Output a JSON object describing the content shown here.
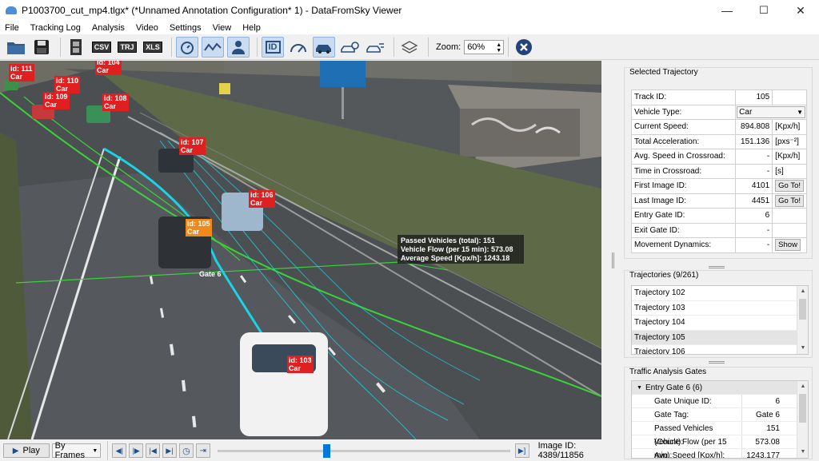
{
  "window": {
    "title": "P1003700_cut_mp4.tlgx* (*Unnamed Annotation Configuration* 1) - DataFromSky Viewer",
    "controls": {
      "minimize": "—",
      "maximize": "☐",
      "close": "✕"
    }
  },
  "menu": [
    "File",
    "Tracking Log",
    "Analysis",
    "Video",
    "Settings",
    "View",
    "Help"
  ],
  "toolbar": {
    "buttons": [
      "open-folder",
      "save",
      "film",
      "CSV",
      "TRJ",
      "XLS",
      "speed-timer",
      "trajectory-path",
      "person",
      "ID",
      "speedometer",
      "vehicle-car",
      "vehicle-gate",
      "vehicle-speed",
      "layers"
    ],
    "csv_label": "CSV",
    "trj_label": "TRJ",
    "xls_label": "XLS",
    "id_label": "ID",
    "zoom_label": "Zoom:",
    "zoom_value": "60%"
  },
  "video": {
    "vehicles": [
      {
        "id": "id: 111",
        "type": "Car",
        "color": "red"
      },
      {
        "id": "id: 104",
        "type": "Car",
        "color": "red"
      },
      {
        "id": "id: 110",
        "type": "Car",
        "color": "red"
      },
      {
        "id": "id: 109",
        "type": "Car",
        "color": "red"
      },
      {
        "id": "id: 108",
        "type": "Car",
        "color": "red"
      },
      {
        "id": "id: 107",
        "type": "Car",
        "color": "red"
      },
      {
        "id": "id: 106",
        "type": "Car",
        "color": "red"
      },
      {
        "id": "id: 105",
        "type": "Car",
        "color": "orange"
      },
      {
        "id": "id: 103",
        "type": "Car",
        "color": "red"
      }
    ],
    "gate_label": "Gate 6",
    "stats": {
      "line1": "Passed Vehicles (total): 151",
      "line2": "Vehicle Flow (per 15 min): 573.08",
      "line3": "Average Speed [Kpx/h]: 1243.18"
    },
    "colors": {
      "label_red": "#e02020",
      "label_orange": "#ef8a1a",
      "trajectory_green": "#39d339",
      "trajectory_cyan": "#19d4e6"
    }
  },
  "selected_trajectory": {
    "title": "Selected Trajectory",
    "rows": [
      {
        "label": "Track ID:",
        "value": "105",
        "unit": ""
      },
      {
        "label": "Vehicle Type:",
        "value": "Car",
        "unit": ""
      },
      {
        "label": "Current Speed:",
        "value": "894.808",
        "unit": "[Kpx/h]"
      },
      {
        "label": "Total Acceleration:",
        "value": "151.136",
        "unit": "[pxs⁻²]"
      },
      {
        "label": "Avg. Speed in Crossroad:",
        "value": "-",
        "unit": "[Kpx/h]"
      },
      {
        "label": "Time in Crossroad:",
        "value": "-",
        "unit": "[s]"
      },
      {
        "label": "First Image ID:",
        "value": "4101",
        "unit": "Go To!"
      },
      {
        "label": "Last Image ID:",
        "value": "4451",
        "unit": "Go To!"
      },
      {
        "label": "Entry Gate ID:",
        "value": "6",
        "unit": ""
      },
      {
        "label": "Exit Gate ID:",
        "value": "-",
        "unit": ""
      },
      {
        "label": "Movement Dynamics:",
        "value": "-",
        "unit": "Show"
      }
    ]
  },
  "trajectories": {
    "title": "Trajectories (9/261)",
    "items": [
      "Trajectory 102",
      "Trajectory 103",
      "Trajectory 104",
      "Trajectory 105",
      "Trajectory 106"
    ],
    "selected_index": 3
  },
  "gates": {
    "title": "Traffic Analysis Gates",
    "node": "Entry Gate 6 (6)",
    "rows": [
      {
        "k": "Gate Unique ID:",
        "v": "6"
      },
      {
        "k": "Gate Tag:",
        "v": "Gate 6"
      },
      {
        "k": "Passed Vehicles (Count):",
        "v": "151"
      },
      {
        "k": "Vehicle Flow (per 15 min):",
        "v": "573.08"
      },
      {
        "k": "Avg. Speed [Kpx/h]:",
        "v": "1243.177"
      }
    ]
  },
  "playback": {
    "play_label": "Play",
    "mode_label": "By Frames",
    "progress": 0.3705,
    "image_id_label": "Image ID:",
    "image_id_value": "4389/11856"
  }
}
